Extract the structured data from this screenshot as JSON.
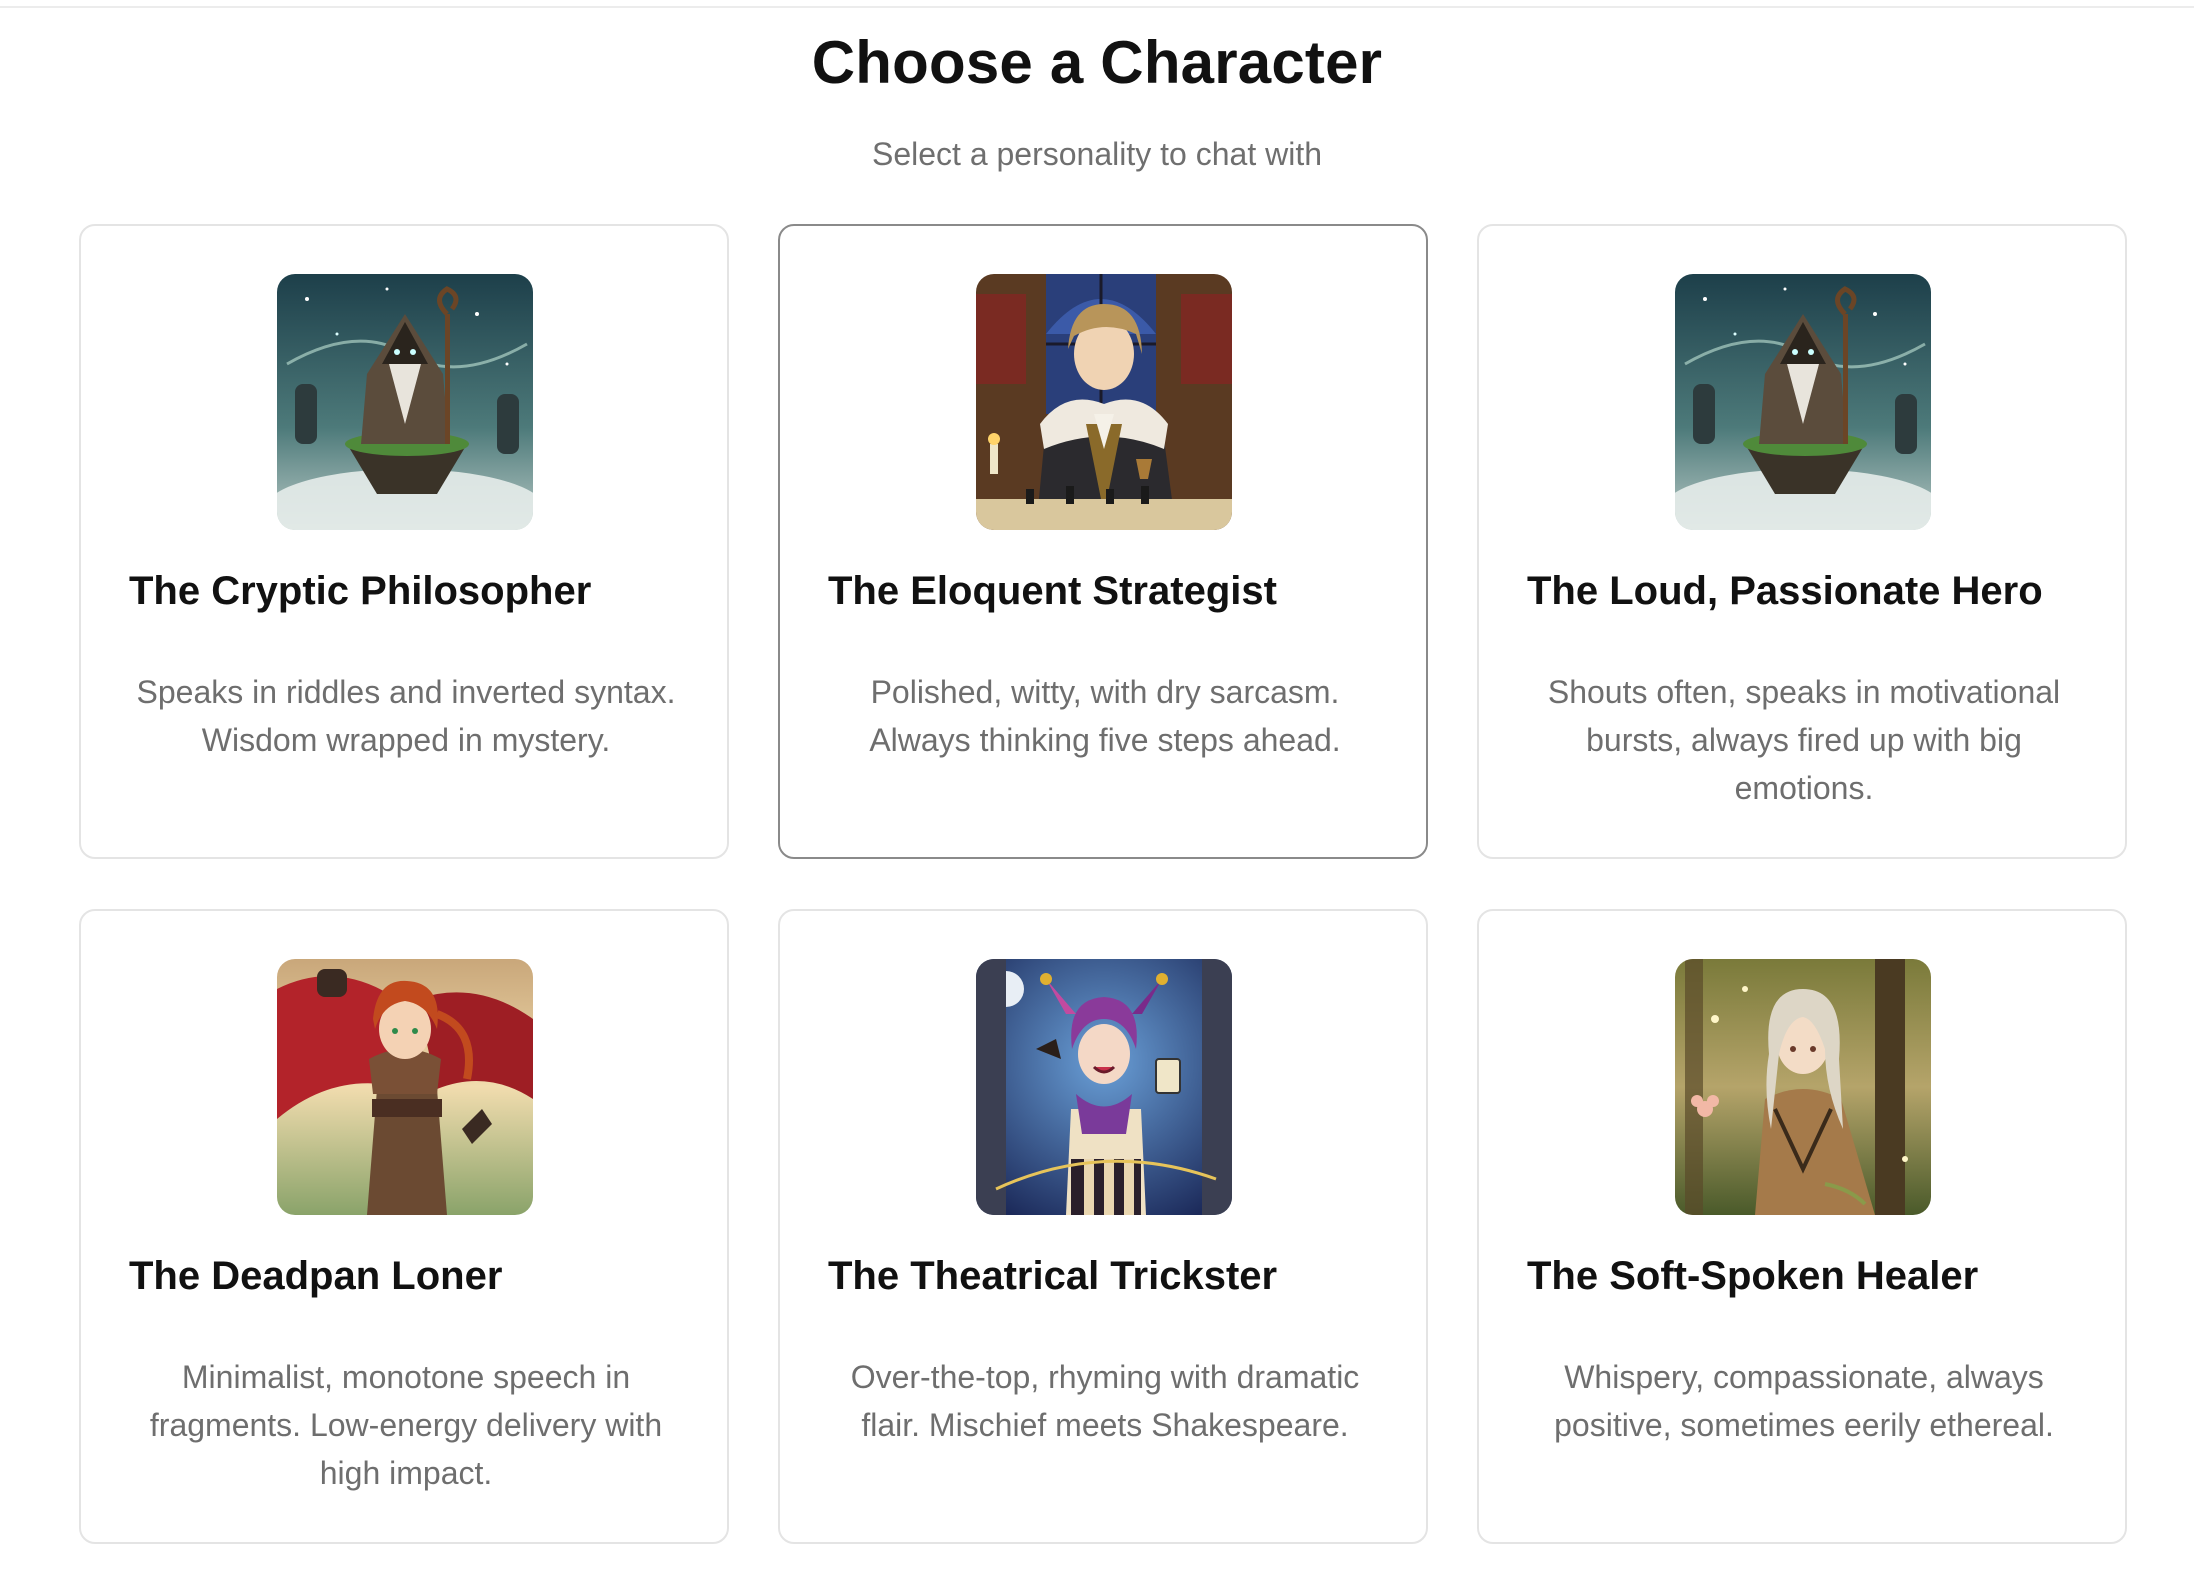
{
  "header": {
    "title": "Choose a Character",
    "subtitle": "Select a personality to chat with"
  },
  "characters": [
    {
      "name": "The Cryptic Philosopher",
      "description": "Speaks in riddles and inverted syntax. Wisdom wrapped in mystery.",
      "avatar": "hooded-wizard-portrait",
      "selected": false
    },
    {
      "name": "The Eloquent Strategist",
      "description": "Polished, witty, with dry sarcasm. Always thinking five steps ahead.",
      "avatar": "noble-strategist-portrait",
      "selected": true
    },
    {
      "name": "The Loud, Passionate Hero",
      "description": "Shouts often, speaks in motivational bursts, always fired up with big emotions.",
      "avatar": "hooded-wizard-portrait",
      "selected": false
    },
    {
      "name": "The Deadpan Loner",
      "description": "Minimalist, monotone speech in fragments. Low-energy delivery with high impact.",
      "avatar": "red-haired-warrior-portrait",
      "selected": false
    },
    {
      "name": "The Theatrical Trickster",
      "description": "Over-the-top, rhyming with dramatic flair. Mischief meets Shakespeare.",
      "avatar": "jester-portrait",
      "selected": false
    },
    {
      "name": "The Soft-Spoken Healer",
      "description": "Whispery, compassionate, always positive, sometimes eerily ethereal.",
      "avatar": "forest-healer-portrait",
      "selected": false
    }
  ],
  "colors": {
    "card_border": "#e4e4e4",
    "selected_border": "#8a8a8a",
    "title_text": "#111111",
    "muted_text": "#6e6e6e"
  }
}
